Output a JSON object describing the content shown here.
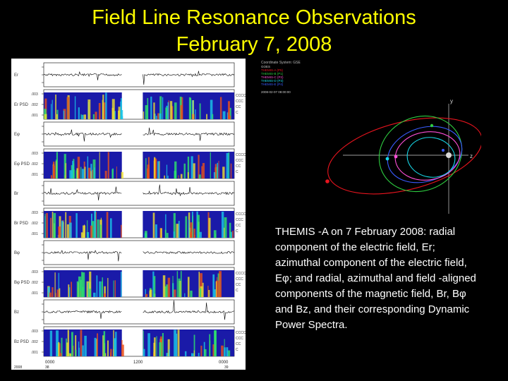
{
  "slide": {
    "title_line1": "Field Line Resonance Observations",
    "title_line2": "February 7, 2008",
    "caption": "THEMIS -A on 7 February 2008: radial component of the electric field, Er; azimuthal component of the electric field, Eφ; and radial, azimuthal and field -aligned components of the magnetic field, Br, Bφ and Bz, and their corresponding Dynamic Power Spectra."
  },
  "colors": {
    "title": "#ffff00",
    "caption": "#ffffff",
    "background": "#000000",
    "orbit_red": "#e8141e",
    "orbit_green": "#2ecc40",
    "orbit_blue": "#3a5cff",
    "orbit_pink": "#ff4fd8",
    "orbit_cyan": "#17d6e6",
    "spectrogram_base": "#1a1aa8"
  },
  "orbit_plot": {
    "header": "Coordinate System: GSE",
    "legend": [
      "GOES",
      "THEMIS-A (P5)",
      "THEMIS-B (P1)",
      "THEMIS-C (P2)",
      "THEMIS-D (P3)",
      "THEMIS-E (P4)"
    ],
    "timestamp": "2008-02-07 08:00:00",
    "axis_y": "y",
    "axis_z": "z"
  },
  "stackplot": {
    "time_start": "0000",
    "time_mid": "1200",
    "time_end": "0000",
    "doy_start": "38",
    "doy_end": "39",
    "year": "2008",
    "spectro_labels": [
      "CCCC",
      "CCC",
      "CC",
      "C"
    ],
    "freq_ticks": [
      ".003",
      ".002",
      ".001"
    ],
    "panel_labels": [
      "Er",
      "Er PSD",
      "Eφ",
      "Eφ PSD",
      "Br",
      "Br PSD",
      "Bφ",
      "Bφ PSD",
      "Bz",
      "Bz PSD"
    ]
  }
}
